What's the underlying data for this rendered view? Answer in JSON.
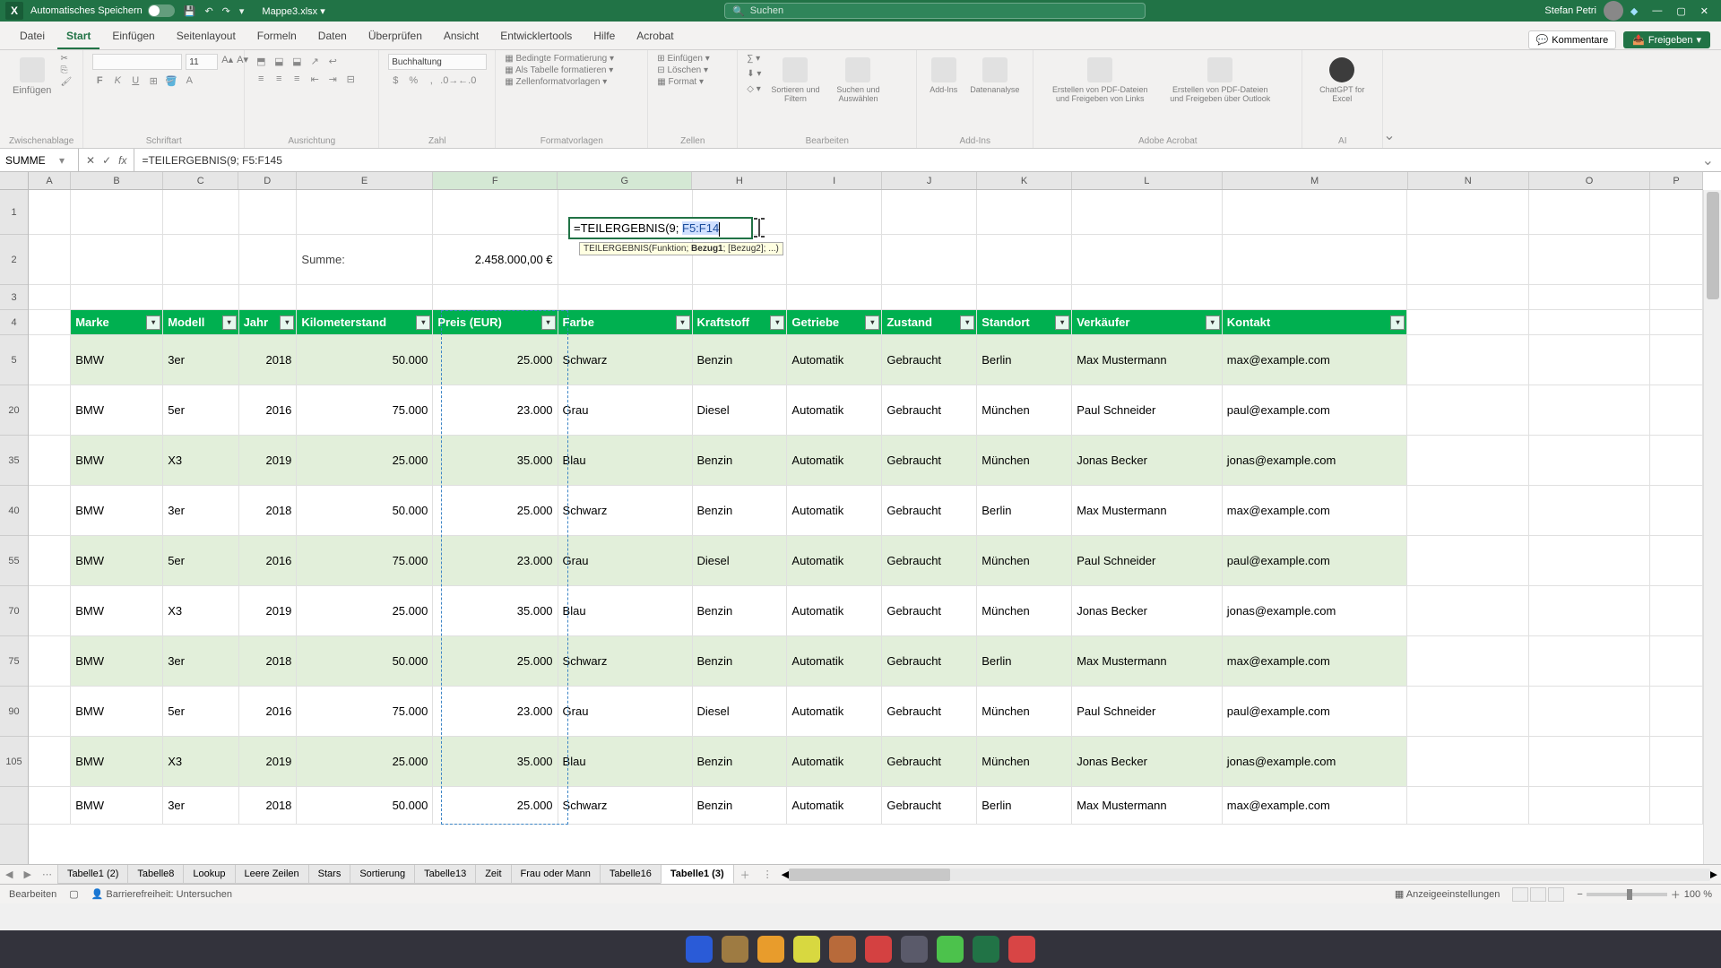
{
  "titlebar": {
    "autosave_label": "Automatisches Speichern",
    "filename": "Mappe3.xlsx",
    "search_placeholder": "Suchen",
    "username": "Stefan Petri"
  },
  "ribbon_tabs": [
    "Datei",
    "Start",
    "Einfügen",
    "Seitenlayout",
    "Formeln",
    "Daten",
    "Überprüfen",
    "Ansicht",
    "Entwicklertools",
    "Hilfe",
    "Acrobat"
  ],
  "ribbon_active_tab": "Start",
  "ribbon_right": {
    "comments": "Kommentare",
    "share": "Freigeben"
  },
  "ribbon_groups": {
    "clipboard": {
      "paste": "Einfügen",
      "label": "Zwischenablage"
    },
    "font": {
      "label": "Schriftart",
      "size": "11"
    },
    "alignment": {
      "label": "Ausrichtung"
    },
    "number": {
      "label": "Zahl",
      "format": "Buchhaltung"
    },
    "styles": {
      "cond": "Bedingte Formatierung",
      "table": "Als Tabelle formatieren",
      "cell": "Zellenformatvorlagen",
      "label": "Formatvorlagen"
    },
    "cells": {
      "insert": "Einfügen",
      "delete": "Löschen",
      "format": "Format",
      "label": "Zellen"
    },
    "editing": {
      "sortfilter": "Sortieren und Filtern",
      "find": "Suchen und Auswählen",
      "label": "Bearbeiten"
    },
    "addins": {
      "addins": "Add-Ins",
      "data": "Datenanalyse",
      "label": "Add-Ins"
    },
    "acrobat": {
      "create": "Erstellen von PDF-Dateien und Freigeben von Links",
      "outlook": "Erstellen von PDF-Dateien und Freigeben über Outlook",
      "label": "Adobe Acrobat"
    },
    "ai": {
      "gpt": "ChatGPT for Excel",
      "label": "AI"
    }
  },
  "namebox": "SUMME",
  "formula": "=TEILERGEBNIS(9; F5:F145",
  "columns": [
    "A",
    "B",
    "C",
    "D",
    "E",
    "F",
    "G",
    "H",
    "I",
    "J",
    "K",
    "L",
    "M",
    "N",
    "O",
    "P"
  ],
  "row_numbers": [
    "1",
    "2",
    "3",
    "4",
    "5",
    "20",
    "35",
    "40",
    "55",
    "70",
    "75",
    "90",
    "105",
    ""
  ],
  "summe": {
    "label": "Summe:",
    "value": "2.458.000,00 €"
  },
  "editing": {
    "prefix": "=TEILERGEBNIS(9; ",
    "ref": "F5:F14",
    "tooltip_fn": "TEILERGEBNIS(",
    "tooltip_args": "Funktion; ",
    "tooltip_bold": "Bezug1",
    "tooltip_rest": "; [Bezug2]; ...)"
  },
  "table_headers": [
    "Marke",
    "Modell",
    "Jahr",
    "Kilometerstand",
    "Preis (EUR)",
    "Farbe",
    "Kraftstoff",
    "Getriebe",
    "Zustand",
    "Standort",
    "Verkäufer",
    "Kontakt"
  ],
  "rows": [
    {
      "marke": "BMW",
      "modell": "3er",
      "jahr": "2018",
      "km": "50.000",
      "preis": "25.000",
      "farbe": "Schwarz",
      "kraftstoff": "Benzin",
      "getriebe": "Automatik",
      "zustand": "Gebraucht",
      "standort": "Berlin",
      "verk": "Max Mustermann",
      "kontakt": "max@example.com"
    },
    {
      "marke": "BMW",
      "modell": "5er",
      "jahr": "2016",
      "km": "75.000",
      "preis": "23.000",
      "farbe": "Grau",
      "kraftstoff": "Diesel",
      "getriebe": "Automatik",
      "zustand": "Gebraucht",
      "standort": "München",
      "verk": "Paul Schneider",
      "kontakt": "paul@example.com"
    },
    {
      "marke": "BMW",
      "modell": "X3",
      "jahr": "2019",
      "km": "25.000",
      "preis": "35.000",
      "farbe": "Blau",
      "kraftstoff": "Benzin",
      "getriebe": "Automatik",
      "zustand": "Gebraucht",
      "standort": "München",
      "verk": "Jonas Becker",
      "kontakt": "jonas@example.com"
    },
    {
      "marke": "BMW",
      "modell": "3er",
      "jahr": "2018",
      "km": "50.000",
      "preis": "25.000",
      "farbe": "Schwarz",
      "kraftstoff": "Benzin",
      "getriebe": "Automatik",
      "zustand": "Gebraucht",
      "standort": "Berlin",
      "verk": "Max Mustermann",
      "kontakt": "max@example.com"
    },
    {
      "marke": "BMW",
      "modell": "5er",
      "jahr": "2016",
      "km": "75.000",
      "preis": "23.000",
      "farbe": "Grau",
      "kraftstoff": "Diesel",
      "getriebe": "Automatik",
      "zustand": "Gebraucht",
      "standort": "München",
      "verk": "Paul Schneider",
      "kontakt": "paul@example.com"
    },
    {
      "marke": "BMW",
      "modell": "X3",
      "jahr": "2019",
      "km": "25.000",
      "preis": "35.000",
      "farbe": "Blau",
      "kraftstoff": "Benzin",
      "getriebe": "Automatik",
      "zustand": "Gebraucht",
      "standort": "München",
      "verk": "Jonas Becker",
      "kontakt": "jonas@example.com"
    },
    {
      "marke": "BMW",
      "modell": "3er",
      "jahr": "2018",
      "km": "50.000",
      "preis": "25.000",
      "farbe": "Schwarz",
      "kraftstoff": "Benzin",
      "getriebe": "Automatik",
      "zustand": "Gebraucht",
      "standort": "Berlin",
      "verk": "Max Mustermann",
      "kontakt": "max@example.com"
    },
    {
      "marke": "BMW",
      "modell": "5er",
      "jahr": "2016",
      "km": "75.000",
      "preis": "23.000",
      "farbe": "Grau",
      "kraftstoff": "Diesel",
      "getriebe": "Automatik",
      "zustand": "Gebraucht",
      "standort": "München",
      "verk": "Paul Schneider",
      "kontakt": "paul@example.com"
    },
    {
      "marke": "BMW",
      "modell": "X3",
      "jahr": "2019",
      "km": "25.000",
      "preis": "35.000",
      "farbe": "Blau",
      "kraftstoff": "Benzin",
      "getriebe": "Automatik",
      "zustand": "Gebraucht",
      "standort": "München",
      "verk": "Jonas Becker",
      "kontakt": "jonas@example.com"
    },
    {
      "marke": "BMW",
      "modell": "3er",
      "jahr": "2018",
      "km": "50.000",
      "preis": "25.000",
      "farbe": "Schwarz",
      "kraftstoff": "Benzin",
      "getriebe": "Automatik",
      "zustand": "Gebraucht",
      "standort": "Berlin",
      "verk": "Max Mustermann",
      "kontakt": "max@example.com"
    }
  ],
  "sheet_tabs": [
    "Tabelle1 (2)",
    "Tabelle8",
    "Lookup",
    "Leere Zeilen",
    "Stars",
    "Sortierung",
    "Tabelle13",
    "Zeit",
    "Frau oder Mann",
    "Tabelle16",
    "Tabelle1 (3)"
  ],
  "active_sheet": "Tabelle1 (3)",
  "statusbar": {
    "mode": "Bearbeiten",
    "accessibility": "Barrierefreiheit: Untersuchen",
    "display": "Anzeigeeinstellungen",
    "zoom": "100 %"
  }
}
